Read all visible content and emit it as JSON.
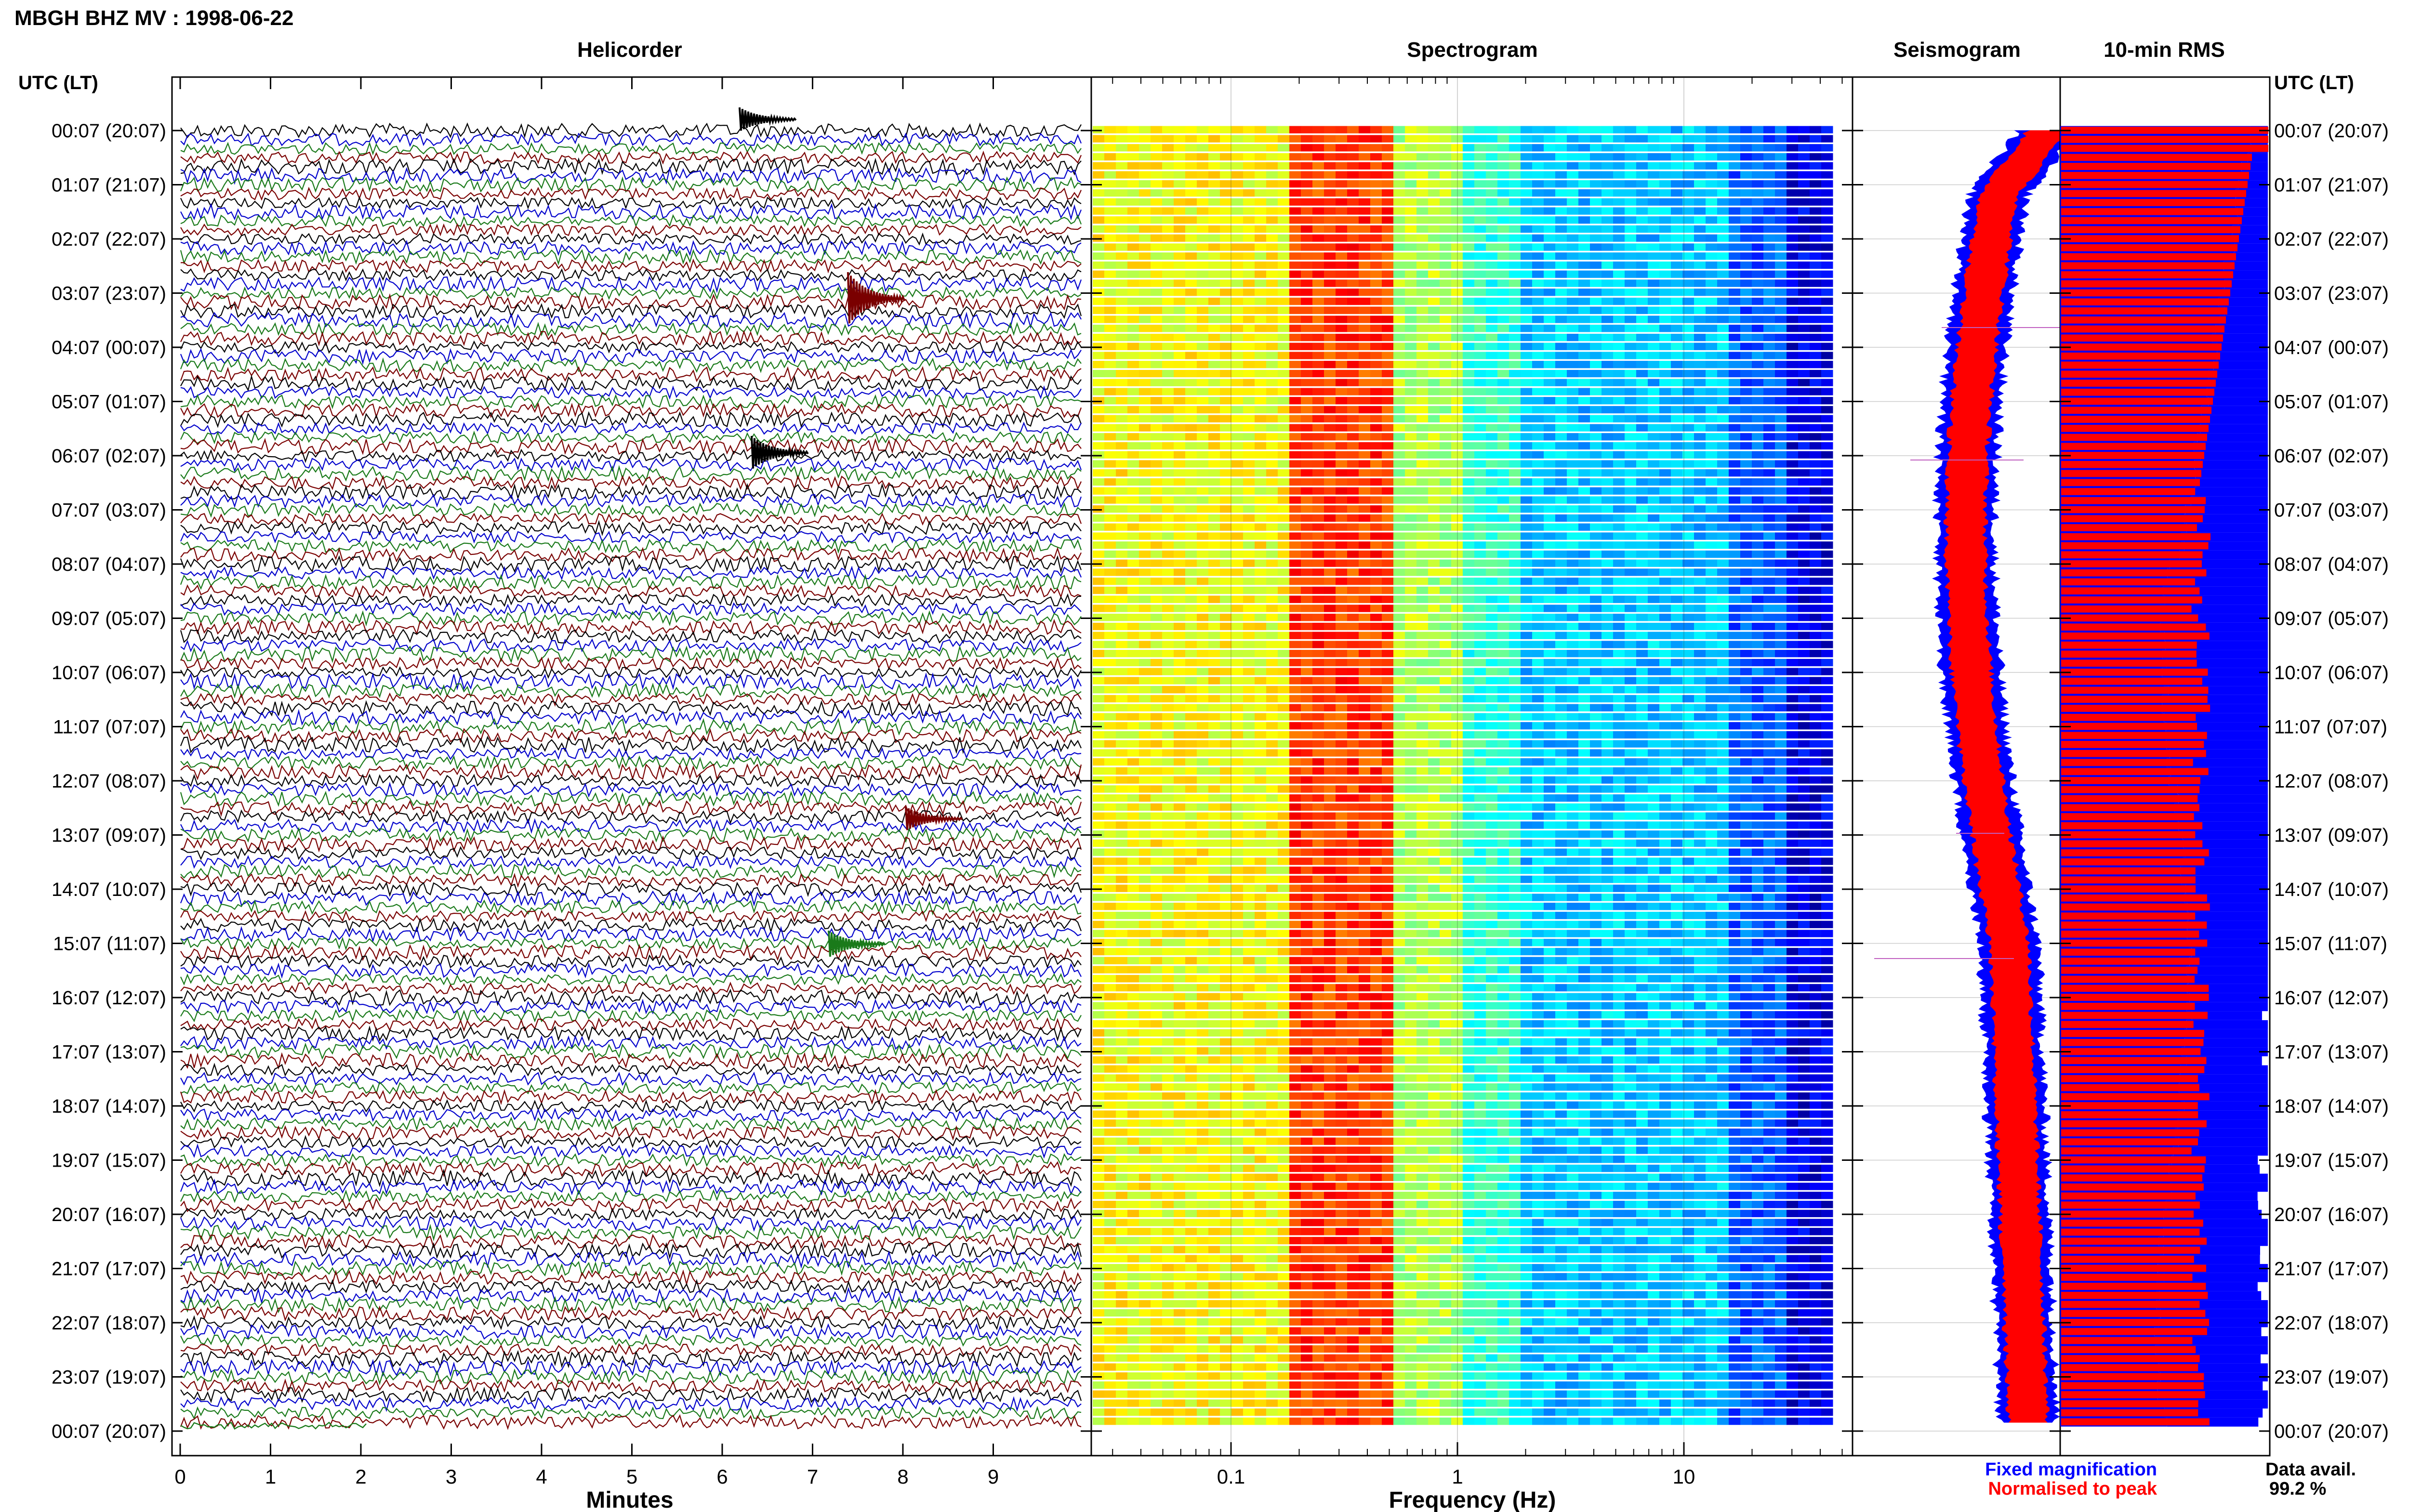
{
  "header": {
    "title": "MBGH BHZ MV : 1998-06-22"
  },
  "panels": {
    "helicorder": "Helicorder",
    "spectrogram": "Spectrogram",
    "seismogram": "Seismogram",
    "rms": "10-min RMS"
  },
  "axes": {
    "time_label_left": "UTC (LT)",
    "time_label_right": "UTC (LT)",
    "helicorder_xlabel": "Minutes",
    "spectrogram_xlabel": "Frequency (Hz)"
  },
  "legend": {
    "fixed": "Fixed magnification",
    "normalised": "Normalised to peak",
    "fixed_color": "#0000ff",
    "normalised_color": "#ff0000"
  },
  "data_availability": {
    "label": "Data avail.",
    "value": "99.2 %"
  },
  "chart_data": {
    "type": "heatmap",
    "title": "MBGH BHZ MV : 1998-06-22",
    "time_ticks": [
      "00:07 (20:07)",
      "01:07 (21:07)",
      "02:07 (22:07)",
      "03:07 (23:07)",
      "04:07 (00:07)",
      "05:07 (01:07)",
      "06:07 (02:07)",
      "07:07 (03:07)",
      "08:07 (04:07)",
      "09:07 (05:07)",
      "10:07 (06:07)",
      "11:07 (07:07)",
      "12:07 (08:07)",
      "13:07 (09:07)",
      "14:07 (10:07)",
      "15:07 (11:07)",
      "16:07 (12:07)",
      "17:07 (13:07)",
      "18:07 (14:07)",
      "19:07 (15:07)",
      "20:07 (16:07)",
      "21:07 (17:07)",
      "22:07 (18:07)",
      "23:07 (19:07)",
      "00:07 (20:07)"
    ],
    "helicorder": {
      "x_ticks": [
        "0",
        "1",
        "2",
        "3",
        "4",
        "5",
        "6",
        "7",
        "8",
        "9"
      ],
      "xlim": [
        0,
        10
      ],
      "rows": 144,
      "trace_colors": [
        "#000000",
        "#0000cc",
        "#1a7a1a",
        "#7a0000"
      ]
    },
    "spectrogram": {
      "x_ticks": [
        "0.1",
        "1",
        "10"
      ],
      "xscale": "log",
      "xlim": [
        0.025,
        50
      ],
      "rows": 144
    },
    "seismogram": {
      "series": [
        {
          "name": "Fixed magnification",
          "color": "#0000ff"
        },
        {
          "name": "Normalised to peak",
          "color": "#ff0000"
        }
      ]
    },
    "rms": {
      "series": [
        {
          "name": "Fixed magnification",
          "color": "#0000ff"
        },
        {
          "name": "Normalised to peak",
          "color": "#ff0000"
        }
      ]
    }
  }
}
